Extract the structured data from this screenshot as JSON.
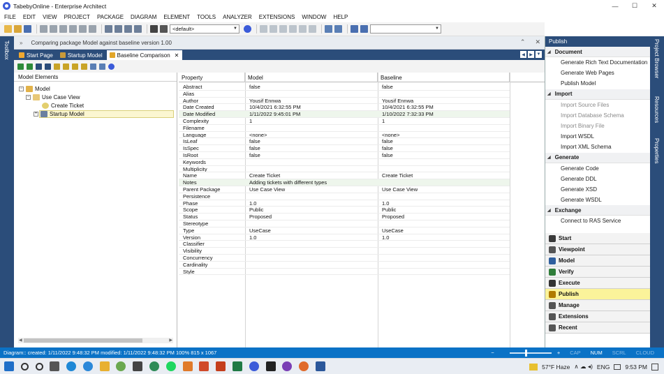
{
  "window": {
    "title": "TabebyOnline - Enterprise Architect",
    "controls": [
      "—",
      "☐",
      "✕"
    ]
  },
  "menu": [
    "FILE",
    "EDIT",
    "VIEW",
    "PROJECT",
    "PACKAGE",
    "DIAGRAM",
    "ELEMENT",
    "TOOLS",
    "ANALYZER",
    "EXTENSIONS",
    "WINDOW",
    "HELP"
  ],
  "toolbar": {
    "perspective_value": "<default>",
    "search_value": ""
  },
  "left_strip": {
    "label": "Toolbox"
  },
  "infobar": {
    "chevron": "»",
    "message": "Comparing package Model against baseline version 1.00",
    "pin": "⌃",
    "close": "✕"
  },
  "tabs": [
    {
      "label": "Start Page",
      "active": false
    },
    {
      "label": "Startup Model",
      "active": false
    },
    {
      "label": "Baseline Comparison",
      "active": true,
      "close": "✕"
    }
  ],
  "tab_nav": [
    "◀",
    "▶",
    "▼"
  ],
  "tree": {
    "header": "Model Elements",
    "nodes": [
      {
        "label": "Model",
        "toggle": "−"
      },
      {
        "label": "Use Case View",
        "toggle": "−"
      },
      {
        "label": "Create Ticket",
        "selected": true
      },
      {
        "label": "Startup Model",
        "toggle": "+"
      }
    ]
  },
  "grid": {
    "columns": [
      "Property",
      "Model",
      "Baseline"
    ],
    "rows": [
      [
        "Abstract",
        "false",
        "false"
      ],
      [
        "Alias",
        "",
        ""
      ],
      [
        "Author",
        "Yousif Ennwa",
        "Yousif Ennwa"
      ],
      [
        "Date Created",
        "10/4/2021 6:32:55 PM",
        "10/4/2021 6:32:55 PM"
      ],
      [
        "Date Modified",
        "1/11/2022 9:45:01 PM",
        "1/10/2022 7:32:33 PM"
      ],
      [
        "Complexity",
        "1",
        "1"
      ],
      [
        "Filename",
        "",
        ""
      ],
      [
        "Language",
        "<none>",
        "<none>"
      ],
      [
        "IsLeaf",
        "false",
        "false"
      ],
      [
        "IsSpec",
        "false",
        "false"
      ],
      [
        "IsRoot",
        "false",
        "false"
      ],
      [
        "Keywords",
        "",
        ""
      ],
      [
        "Multiplicity",
        "",
        ""
      ],
      [
        "Name",
        "Create Ticket",
        "Create Ticket"
      ],
      [
        "Notes",
        "Adding tickets with different types",
        ""
      ],
      [
        "Parent Package",
        "Use Case View",
        "Use Case View"
      ],
      [
        "Persistence",
        "",
        ""
      ],
      [
        "Phase",
        "1.0",
        "1.0"
      ],
      [
        "Scope",
        "Public",
        "Public"
      ],
      [
        "Status",
        "Proposed",
        "Proposed"
      ],
      [
        "Stereotype",
        "",
        ""
      ],
      [
        "Type",
        "UseCase",
        "UseCase"
      ],
      [
        "Version",
        "1.0",
        "1.0"
      ],
      [
        "Classifier",
        "",
        ""
      ],
      [
        "Visibility",
        "",
        ""
      ],
      [
        "Concurrency",
        "",
        ""
      ],
      [
        "Cardinality",
        "",
        ""
      ],
      [
        "Style",
        "",
        ""
      ]
    ],
    "changed_rows": [
      "Date Modified",
      "Notes"
    ]
  },
  "publish_panel": {
    "title": "Publish",
    "sections": [
      {
        "label": "Document",
        "items": [
          {
            "label": "Generate Rich Text Documentation",
            "enabled": true
          },
          {
            "label": "Generate Web Pages",
            "enabled": true
          },
          {
            "label": "Publish Model",
            "enabled": true
          }
        ]
      },
      {
        "label": "Import",
        "items": [
          {
            "label": "Import Source Files",
            "enabled": false
          },
          {
            "label": "Import Database Schema",
            "enabled": false
          },
          {
            "label": "Import Binary File",
            "enabled": false
          },
          {
            "label": "Import WSDL",
            "enabled": true
          },
          {
            "label": "Import XML Schema",
            "enabled": true
          }
        ]
      },
      {
        "label": "Generate",
        "items": [
          {
            "label": "Generate Code",
            "enabled": true
          },
          {
            "label": "Generate DDL",
            "enabled": true
          },
          {
            "label": "Generate XSD",
            "enabled": true
          },
          {
            "label": "Generate WSDL",
            "enabled": true
          }
        ]
      },
      {
        "label": "Exchange",
        "items": [
          {
            "label": "Connect to RAS Service",
            "enabled": true
          }
        ]
      }
    ],
    "nav": [
      {
        "label": "Start",
        "color": "#3a3a3a"
      },
      {
        "label": "Viewpoint",
        "color": "#555555"
      },
      {
        "label": "Model",
        "color": "#2f5f9e"
      },
      {
        "label": "Verify",
        "color": "#2f7d3a"
      },
      {
        "label": "Execute",
        "color": "#333333"
      },
      {
        "label": "Publish",
        "color": "#b07a00",
        "active": true
      },
      {
        "label": "Manage",
        "color": "#555555"
      },
      {
        "label": "Extensions",
        "color": "#555555"
      },
      {
        "label": "Recent",
        "color": "#555555"
      }
    ]
  },
  "right_strip": [
    "Project Browser",
    "Resources",
    "Properties"
  ],
  "status": {
    "left": "Diagram::  created: 1/11/2022 9:48:32 PM  modified: 1/11/2022 9:48:32 PM  100%  815 x 1067",
    "zoom_minus": "−",
    "zoom_plus": "+",
    "indicators": [
      {
        "label": "CAP",
        "active": false
      },
      {
        "label": "NUM",
        "active": true
      },
      {
        "label": "SCRL",
        "active": false
      },
      {
        "label": "CLOUD",
        "active": false
      }
    ]
  },
  "taskbar": {
    "weather": "57°F  Haze",
    "lang": "ENG",
    "time": "9:53 PM",
    "tray_glyphs": "∧ ☁ ◂)"
  },
  "colors": {
    "accent": "#2b4d7a",
    "status": "#0b72c6",
    "changed_row": "#eef6ec",
    "selected": "#fbf39a"
  }
}
